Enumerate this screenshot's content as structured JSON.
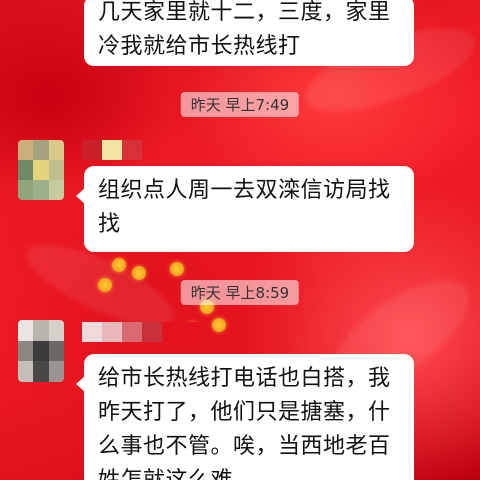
{
  "chat": {
    "messages": [
      {
        "kind": "incoming",
        "lines": [
          "几天家里就十二，三度，家里",
          "冷我就给市长热线打"
        ]
      },
      {
        "kind": "timestamp",
        "text": "昨天 早上7:49"
      },
      {
        "kind": "incoming",
        "lines": [
          "组织点人周一去双滦信访局找",
          "找"
        ]
      },
      {
        "kind": "timestamp",
        "text": "昨天 早上8:59"
      },
      {
        "kind": "incoming",
        "lines": [
          "给市长热线打电话也白搭，我",
          "昨天打了，他们只是搪塞，什",
          "么事也不管。唉，当西地老百",
          "姓怎就这么难"
        ]
      }
    ]
  },
  "colors": {
    "background": "#e0121d",
    "bubble": "#ffffff",
    "timestamp_bg": "rgba(255,255,255,0.55)"
  }
}
